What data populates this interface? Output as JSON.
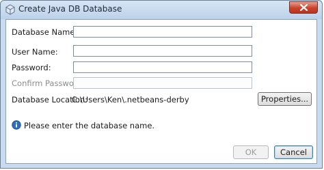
{
  "window": {
    "title": "Create Java DB Database"
  },
  "form": {
    "database_name_label": "Database Name:",
    "user_name_label": "User Name:",
    "password_label": "Password:",
    "confirm_password_label": "Confirm Password:",
    "database_location_label": "Database Location:",
    "database_location_value": "C:\\Users\\Ken\\.netbeans-derby",
    "database_name_value": "",
    "user_name_value": "",
    "password_value": "",
    "confirm_password_value": ""
  },
  "buttons": {
    "properties_label": "Properties...",
    "ok_label": "OK",
    "cancel_label": "Cancel"
  },
  "status": {
    "message": "Please enter the database name."
  },
  "icons": {
    "app": "netbeans-cube-icon",
    "close": "close-icon",
    "info": "info-icon"
  },
  "colors": {
    "close_button": "#c9432a",
    "info": "#2a6fb8"
  }
}
